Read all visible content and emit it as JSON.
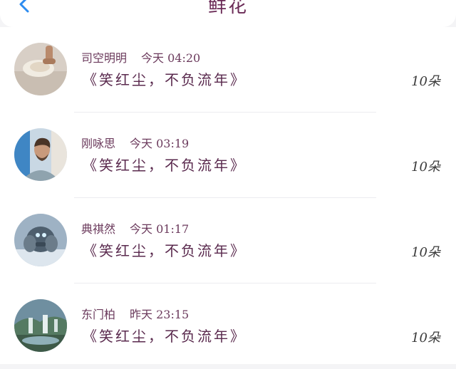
{
  "header": {
    "title": "鲜花",
    "back_icon": "chevron-left-icon",
    "accent": "#2d8cf0"
  },
  "gifts": [
    {
      "name": "司空明明",
      "time": "今天 04:20",
      "message": "《笑红尘，不负流年》",
      "count": "10朵"
    },
    {
      "name": "刚咏思",
      "time": "今天 03:19",
      "message": "《笑红尘，不负流年》",
      "count": "10朵"
    },
    {
      "name": "典祺然",
      "time": "今天 01:17",
      "message": "《笑红尘，不负流年》",
      "count": "10朵"
    },
    {
      "name": "东门柏",
      "time": "昨天 23:15",
      "message": "《笑红尘，不负流年》",
      "count": "10朵"
    }
  ]
}
